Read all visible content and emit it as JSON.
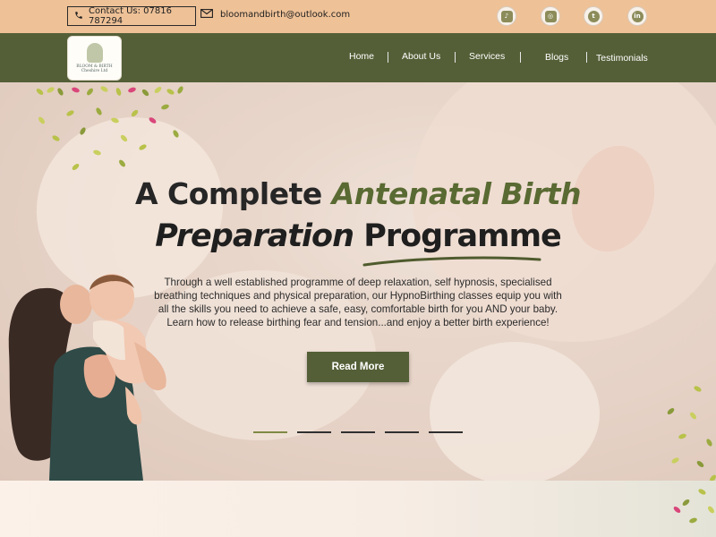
{
  "topbar": {
    "contact_label": "Contact Us: 07816 787294",
    "email": "bloomandbirth@outlook.com",
    "socials": [
      {
        "name": "tiktok",
        "glyph": "♪"
      },
      {
        "name": "instagram",
        "glyph": "◎"
      },
      {
        "name": "twitter",
        "glyph": "t"
      },
      {
        "name": "linkedin",
        "glyph": "in"
      }
    ]
  },
  "nav": {
    "logo_text": "BLOOM & BIRTH",
    "logo_subtext": "Cheshire Ltd",
    "items": [
      "Home",
      "About Us",
      "Services",
      "Blogs",
      "Testimonials"
    ]
  },
  "hero": {
    "title_part1": "A Complete ",
    "title_accent": "Antenatal Birth",
    "title_italic": "Preparation",
    "title_part2": " Programme",
    "description": "Through a well established programme of deep relaxation, self hypnosis, specialised breathing techniques and physical preparation, our HypnoBirthing classes equip you with all the skills you need to achieve a safe, easy, comfortable birth for you AND your baby. Learn how to release birthing fear and tension...and enjoy a better birth experience!",
    "cta_label": "Read More",
    "slides": 5,
    "active_slide": 0
  },
  "colors": {
    "topbar": "#eec197",
    "nav": "#545f37",
    "accent_green": "#596a32",
    "button": "#545f37"
  }
}
